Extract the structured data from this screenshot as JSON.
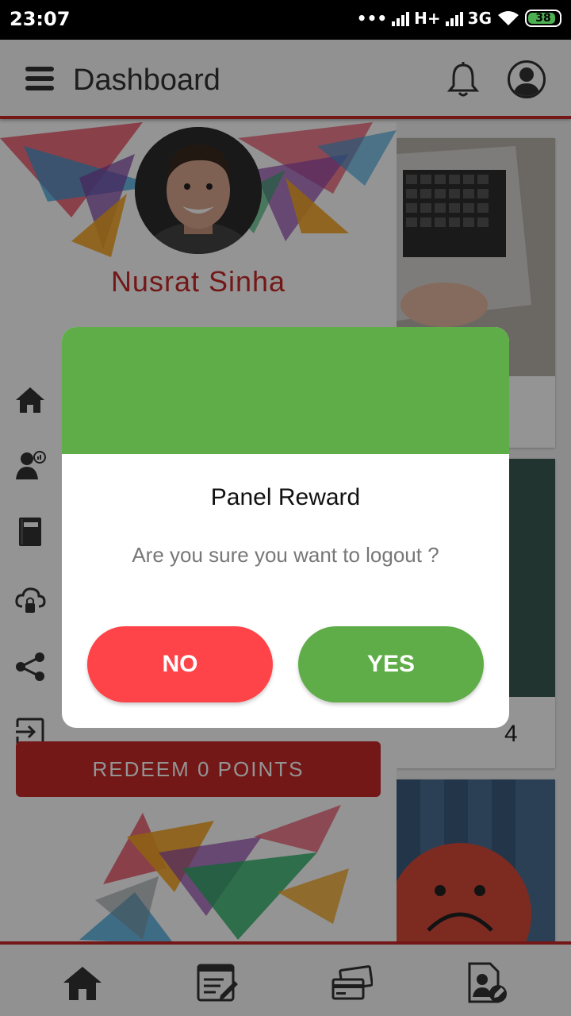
{
  "status_bar": {
    "time": "23:07",
    "dots": "•••",
    "network_primary": "H+",
    "network_secondary": "3G",
    "battery": "38"
  },
  "topbar": {
    "title": "Dashboard",
    "icons": [
      "menu-icon",
      "bell-icon",
      "account-icon"
    ]
  },
  "drawer": {
    "user_name": "Nusrat  Sinha",
    "menu_icons": [
      "home-icon",
      "user-stats-icon",
      "book-icon",
      "cloud-lock-icon",
      "share-icon",
      "logout-icon"
    ],
    "redeem_label": "REDEEM  0  POINTS"
  },
  "content": {
    "card2_value": "4"
  },
  "bottom_nav": {
    "icons": [
      "home-icon",
      "notes-icon",
      "cards-icon",
      "profile-edit-icon"
    ]
  },
  "dialog": {
    "title": "Panel Reward",
    "message": "Are you sure you want to logout ?",
    "no_label": "NO",
    "yes_label": "YES"
  },
  "colors": {
    "accent_red": "#c62828",
    "dialog_green": "#5fad48",
    "no_button": "#fe4448"
  }
}
